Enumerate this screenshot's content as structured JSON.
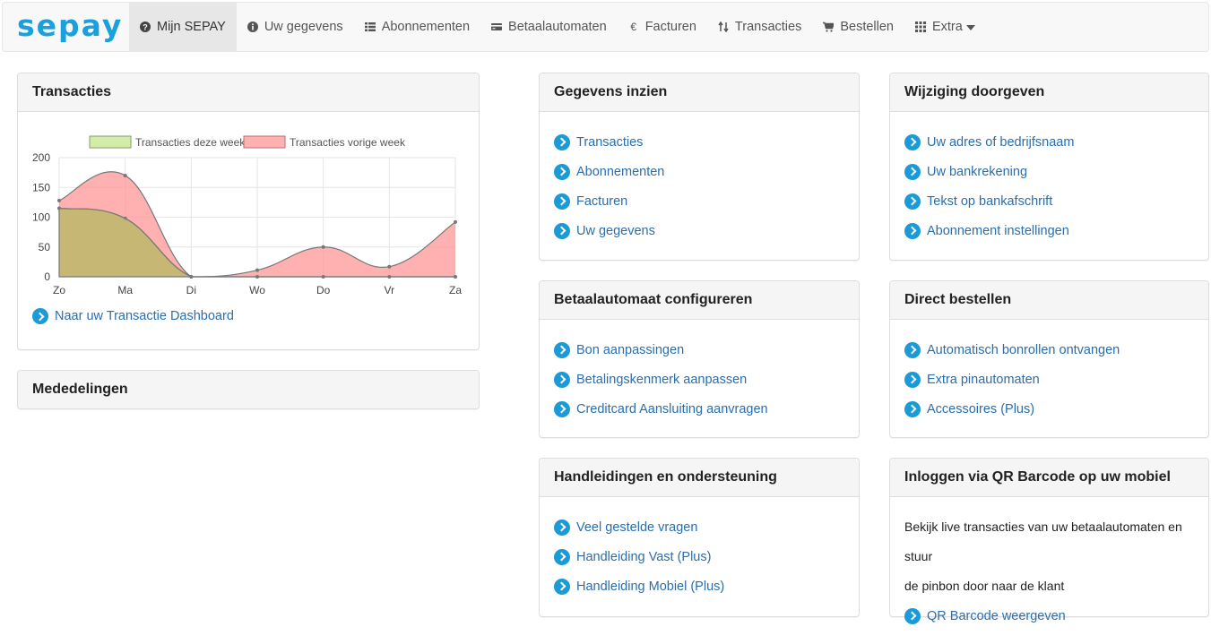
{
  "navbar": {
    "brand": "sepay",
    "items": [
      {
        "label": "Mijn SEPAY",
        "icon": "question-circle-icon",
        "active": true
      },
      {
        "label": "Uw gegevens",
        "icon": "info-circle-icon"
      },
      {
        "label": "Abonnementen",
        "icon": "list-icon"
      },
      {
        "label": "Betaalautomaten",
        "icon": "credit-card-icon"
      },
      {
        "label": "Facturen",
        "icon": "euro-icon"
      },
      {
        "label": "Transacties",
        "icon": "sort-icon"
      },
      {
        "label": "Bestellen",
        "icon": "cart-icon"
      },
      {
        "label": "Extra",
        "icon": "grid-icon"
      }
    ]
  },
  "transacties_panel": {
    "title": "Transacties",
    "dashboard_link": "Naar uw Transactie Dashboard"
  },
  "chart_data": {
    "type": "area",
    "categories": [
      "Zo",
      "Ma",
      "Di",
      "Wo",
      "Do",
      "Vr",
      "Za"
    ],
    "series": [
      {
        "name": "Transacties deze week",
        "values": [
          115,
          98,
          0,
          0,
          0,
          0,
          0
        ],
        "color": "#c8e6a0"
      },
      {
        "name": "Transacties vorige week",
        "values": [
          128,
          170,
          0,
          11,
          50,
          17,
          92
        ],
        "color": "#ff9f9f"
      }
    ],
    "ylim": [
      0,
      200
    ],
    "yticks": [
      0,
      50,
      100,
      150,
      200
    ],
    "grid": true,
    "legend": "top"
  },
  "mededelingen_panel": {
    "title": "Mededelingen"
  },
  "gegevens_panel": {
    "title": "Gegevens inzien",
    "links": [
      "Transacties",
      "Abonnementen",
      "Facturen",
      "Uw gegevens"
    ]
  },
  "wijziging_panel": {
    "title": "Wijziging doorgeven",
    "links": [
      "Uw adres of bedrijfsnaam",
      "Uw bankrekening",
      "Tekst op bankafschrift",
      "Abonnement instellingen"
    ]
  },
  "betaalautomaat_panel": {
    "title": "Betaalautomaat configureren",
    "links": [
      "Bon aanpassingen",
      "Betalingskenmerk aanpassen",
      "Creditcard Aansluiting aanvragen"
    ]
  },
  "direct_panel": {
    "title": "Direct bestellen",
    "links": [
      "Automatisch bonrollen ontvangen",
      "Extra pinautomaten",
      "Accessoires (Plus)"
    ]
  },
  "handleidingen_panel": {
    "title": "Handleidingen en ondersteuning",
    "links": [
      "Veel gestelde vragen",
      "Handleiding Vast (Plus)",
      "Handleiding Mobiel (Plus)"
    ]
  },
  "qr_panel": {
    "title": "Inloggen via QR Barcode op uw mobiel",
    "text_line1": "Bekijk live transacties van uw betaalautomaten en stuur",
    "text_line2": "de pinbon door naar de klant",
    "link": "QR Barcode weergeven"
  }
}
